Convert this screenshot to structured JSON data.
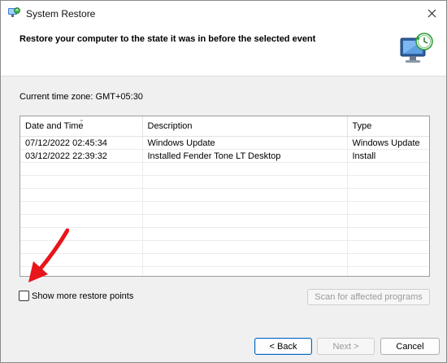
{
  "window": {
    "title": "System Restore",
    "header_title": "Restore your computer to the state it was in before the selected event",
    "close_icon": "close-icon",
    "app_icon": "system-restore-icon"
  },
  "timezone_label": "Current time zone: GMT+05:30",
  "grid": {
    "headers": {
      "date": "Date and Time",
      "description": "Description",
      "type": "Type"
    },
    "rows": [
      {
        "date": "07/12/2022 02:45:34",
        "description": "Windows Update",
        "type": "Windows Update"
      },
      {
        "date": "03/12/2022 22:39:32",
        "description": "Installed Fender Tone LT Desktop",
        "type": "Install"
      }
    ]
  },
  "show_more": {
    "label": "Show more restore points",
    "checked": false
  },
  "buttons": {
    "scan": "Scan for affected programs",
    "back": "< Back",
    "next": "Next >",
    "cancel": "Cancel"
  },
  "colors": {
    "annotation_arrow": "#e8151b",
    "primary_button_border": "#0067c0"
  }
}
